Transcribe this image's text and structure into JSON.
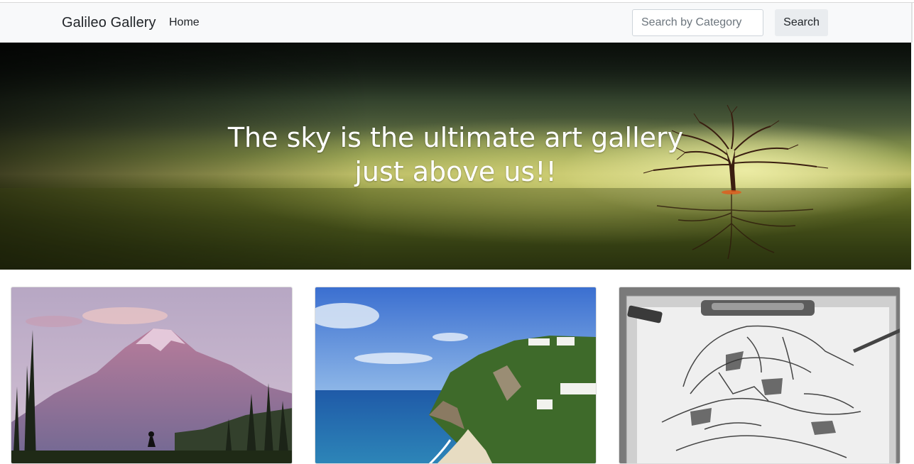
{
  "navbar": {
    "brand": "Galileo Gallery",
    "home_label": "Home",
    "search_placeholder": "Search by Category",
    "search_button": "Search"
  },
  "hero": {
    "title_line1": "The sky is the ultimate art gallery",
    "title_line2": "just above us!!"
  },
  "gallery": {
    "cards": [
      {
        "subject": "mountain-image"
      },
      {
        "subject": "coastline-image"
      },
      {
        "subject": "sketch-image"
      }
    ]
  },
  "colors": {
    "navbar_bg": "#f8f9fa",
    "button_bg": "#e9ecef",
    "text": "#212529"
  }
}
